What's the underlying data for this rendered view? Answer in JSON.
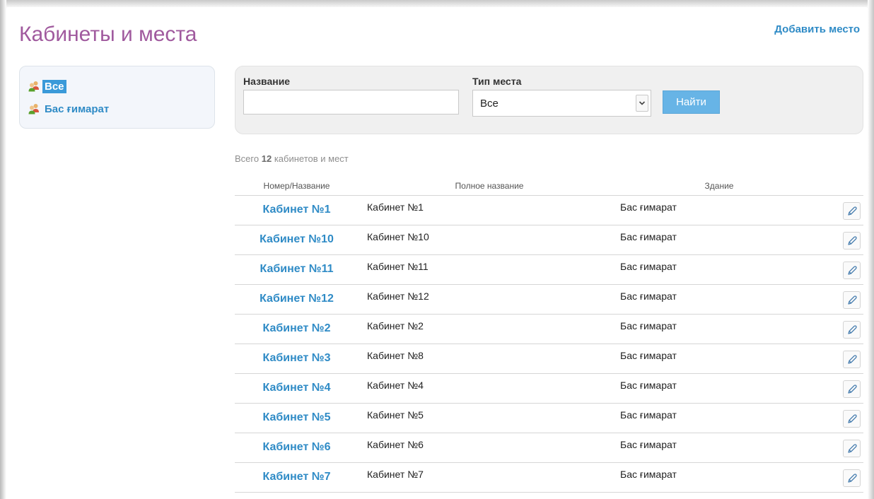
{
  "page": {
    "title": "Кабинеты и места",
    "add_link": "Добавить место"
  },
  "sidebar": {
    "items": [
      {
        "label": "Все",
        "active": true,
        "icon": "people-icon"
      },
      {
        "label": "Бас ғимарат",
        "active": false,
        "icon": "people-icon"
      }
    ]
  },
  "filter": {
    "name_label": "Название",
    "name_value": "",
    "type_label": "Тип места",
    "type_selected": "Все",
    "find_button": "Найти"
  },
  "summary": {
    "prefix": "Всего",
    "count": "12",
    "suffix": "кабинетов и мест"
  },
  "table": {
    "headers": {
      "number": "Номер/Название",
      "full_name": "Полное название",
      "building": "Здание"
    },
    "rows": [
      {
        "number": "Кабинет №1",
        "full_name": "Кабинет №1",
        "building": "Бас ғимарат"
      },
      {
        "number": "Кабинет №10",
        "full_name": "Кабинет №10",
        "building": "Бас ғимарат"
      },
      {
        "number": "Кабинет №11",
        "full_name": "Кабинет №11",
        "building": "Бас ғимарат"
      },
      {
        "number": "Кабинет №12",
        "full_name": "Кабинет №12",
        "building": "Бас ғимарат"
      },
      {
        "number": "Кабинет №2",
        "full_name": "Кабинет №2",
        "building": "Бас ғимарат"
      },
      {
        "number": "Кабинет №3",
        "full_name": "Кабинет №8",
        "building": "Бас ғимарат"
      },
      {
        "number": "Кабинет №4",
        "full_name": "Кабинет №4",
        "building": "Бас ғимарат"
      },
      {
        "number": "Кабинет №5",
        "full_name": "Кабинет №5",
        "building": "Бас ғимарат"
      },
      {
        "number": "Кабинет №6",
        "full_name": "Кабинет №6",
        "building": "Бас ғимарат"
      },
      {
        "number": "Кабинет №7",
        "full_name": "Кабинет №7",
        "building": "Бас ғимарат"
      }
    ]
  },
  "colors": {
    "title": "#a05a9e",
    "link": "#2f8bc6",
    "active_bg": "#3a9ad9",
    "button_bg": "#67b4e6"
  }
}
